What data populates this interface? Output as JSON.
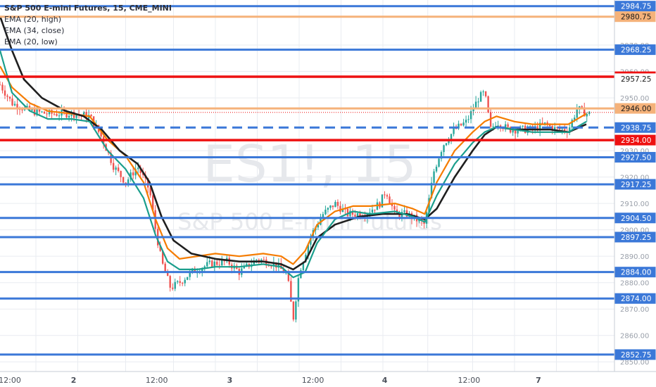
{
  "header": {
    "symbol_title": "S&P 500 E-mini Futures, 15, CME_MINI",
    "indicators": [
      "EMA (20, high)",
      "EMA (34, close)",
      "EMA (20, low)"
    ]
  },
  "watermark": {
    "big": "ES1!, 15",
    "small": "S&P 500 E-mini Futures"
  },
  "colors": {
    "background": "#ffffff",
    "grid": "#e9ecf1",
    "level_blue": "#3b78d8",
    "level_red": "#ee1111",
    "level_orange": "#f5b27a",
    "ema_high": "#f57c00",
    "ema_close": "#1f1f1f",
    "ema_low": "#1a9e8c",
    "candle_up": "#26a69a",
    "candle_down": "#ef5350"
  },
  "chart_data": {
    "type": "line",
    "ylim": [
      2849,
      2986
    ],
    "y_ticks": [
      2850,
      2860,
      2870,
      2880,
      2890,
      2900,
      2910,
      2920,
      2930,
      2950,
      2960,
      2970
    ],
    "x_labels": [
      "12:00",
      "2",
      "12:00",
      "3",
      "12:00",
      "4",
      "12:00",
      "7"
    ],
    "x_label_positions": [
      0.0,
      0.13,
      0.29,
      0.43,
      0.57,
      0.715,
      0.86,
      1.0
    ],
    "x_range": [
      0,
      1
    ],
    "levels": [
      {
        "value": 2984.75,
        "label": "2984.75",
        "style": "blue"
      },
      {
        "value": 2980.75,
        "label": "2980.75",
        "style": "orange"
      },
      {
        "value": 2968.25,
        "label": "2968.25",
        "style": "blue"
      },
      {
        "value": 2958.0,
        "label": "2958.00",
        "style": "red"
      },
      {
        "value": 2957.25,
        "label": "2957.25",
        "style": "plain"
      },
      {
        "value": 2946.0,
        "label": "2946.00",
        "style": "orange"
      },
      {
        "value": 2938.75,
        "label": "2938.75",
        "style": "blue-dashed"
      },
      {
        "value": 2934.0,
        "label": "2934.00",
        "style": "red"
      },
      {
        "value": 2927.5,
        "label": "2927.50",
        "style": "blue"
      },
      {
        "value": 2917.25,
        "label": "2917.25",
        "style": "blue"
      },
      {
        "value": 2904.5,
        "label": "2904.50",
        "style": "blue"
      },
      {
        "value": 2897.25,
        "label": "2897.25",
        "style": "blue"
      },
      {
        "value": 2884.0,
        "label": "2884.00",
        "style": "blue"
      },
      {
        "value": 2874.0,
        "label": "2874.00",
        "style": "blue"
      },
      {
        "value": 2852.75,
        "label": "2852.75",
        "style": "blue"
      }
    ],
    "last_price": 2944.5,
    "price_path": [
      [
        0.0,
        2955
      ],
      [
        0.02,
        2948
      ],
      [
        0.05,
        2945
      ],
      [
        0.08,
        2944
      ],
      [
        0.12,
        2944
      ],
      [
        0.15,
        2943
      ],
      [
        0.17,
        2935
      ],
      [
        0.19,
        2924
      ],
      [
        0.21,
        2918
      ],
      [
        0.23,
        2924
      ],
      [
        0.25,
        2915
      ],
      [
        0.26,
        2900
      ],
      [
        0.27,
        2888
      ],
      [
        0.285,
        2878
      ],
      [
        0.3,
        2880
      ],
      [
        0.32,
        2884
      ],
      [
        0.35,
        2887
      ],
      [
        0.38,
        2888
      ],
      [
        0.4,
        2884
      ],
      [
        0.43,
        2889
      ],
      [
        0.46,
        2887
      ],
      [
        0.48,
        2883
      ],
      [
        0.49,
        2866
      ],
      [
        0.5,
        2884
      ],
      [
        0.52,
        2898
      ],
      [
        0.54,
        2906
      ],
      [
        0.56,
        2910
      ],
      [
        0.58,
        2906
      ],
      [
        0.61,
        2906
      ],
      [
        0.635,
        2910
      ],
      [
        0.645,
        2915
      ],
      [
        0.66,
        2906
      ],
      [
        0.68,
        2906
      ],
      [
        0.71,
        2902
      ],
      [
        0.725,
        2922
      ],
      [
        0.74,
        2932
      ],
      [
        0.76,
        2938
      ],
      [
        0.78,
        2941
      ],
      [
        0.8,
        2950
      ],
      [
        0.81,
        2952
      ],
      [
        0.82,
        2938
      ],
      [
        0.83,
        2941
      ],
      [
        0.85,
        2938
      ],
      [
        0.87,
        2938
      ],
      [
        0.89,
        2938
      ],
      [
        0.91,
        2940
      ],
      [
        0.93,
        2938
      ],
      [
        0.95,
        2938
      ],
      [
        0.965,
        2946
      ],
      [
        0.98,
        2944
      ]
    ],
    "series": [
      {
        "name": "EMA (20, high)",
        "color_key": "ema_high",
        "points": [
          [
            0.0,
            2962
          ],
          [
            0.02,
            2954
          ],
          [
            0.05,
            2948
          ],
          [
            0.08,
            2945
          ],
          [
            0.12,
            2944
          ],
          [
            0.15,
            2943
          ],
          [
            0.18,
            2934
          ],
          [
            0.21,
            2928
          ],
          [
            0.24,
            2918
          ],
          [
            0.26,
            2904
          ],
          [
            0.28,
            2893
          ],
          [
            0.3,
            2889
          ],
          [
            0.33,
            2890
          ],
          [
            0.36,
            2891
          ],
          [
            0.4,
            2890
          ],
          [
            0.44,
            2891
          ],
          [
            0.47,
            2890
          ],
          [
            0.49,
            2887
          ],
          [
            0.51,
            2892
          ],
          [
            0.53,
            2902
          ],
          [
            0.56,
            2907
          ],
          [
            0.59,
            2909
          ],
          [
            0.62,
            2909
          ],
          [
            0.66,
            2910
          ],
          [
            0.69,
            2908
          ],
          [
            0.71,
            2906
          ],
          [
            0.73,
            2918
          ],
          [
            0.76,
            2930
          ],
          [
            0.79,
            2937
          ],
          [
            0.81,
            2941
          ],
          [
            0.83,
            2943
          ],
          [
            0.86,
            2941
          ],
          [
            0.89,
            2940
          ],
          [
            0.92,
            2940
          ],
          [
            0.95,
            2940
          ],
          [
            0.98,
            2944
          ]
        ]
      },
      {
        "name": "EMA (34, close)",
        "color_key": "ema_close",
        "points": [
          [
            0.0,
            2981
          ],
          [
            0.02,
            2968
          ],
          [
            0.04,
            2957
          ],
          [
            0.07,
            2950
          ],
          [
            0.11,
            2945
          ],
          [
            0.14,
            2943
          ],
          [
            0.17,
            2938
          ],
          [
            0.2,
            2930
          ],
          [
            0.23,
            2925
          ],
          [
            0.25,
            2918
          ],
          [
            0.27,
            2905
          ],
          [
            0.29,
            2896
          ],
          [
            0.32,
            2891
          ],
          [
            0.36,
            2889
          ],
          [
            0.4,
            2888
          ],
          [
            0.44,
            2888
          ],
          [
            0.47,
            2887
          ],
          [
            0.49,
            2885
          ],
          [
            0.51,
            2888
          ],
          [
            0.53,
            2897
          ],
          [
            0.56,
            2902
          ],
          [
            0.6,
            2905
          ],
          [
            0.64,
            2906
          ],
          [
            0.68,
            2906
          ],
          [
            0.71,
            2904
          ],
          [
            0.73,
            2908
          ],
          [
            0.76,
            2920
          ],
          [
            0.79,
            2930
          ],
          [
            0.81,
            2936
          ],
          [
            0.83,
            2939
          ],
          [
            0.86,
            2938
          ],
          [
            0.89,
            2938
          ],
          [
            0.92,
            2938
          ],
          [
            0.95,
            2937
          ],
          [
            0.98,
            2940
          ]
        ]
      },
      {
        "name": "EMA (20, low)",
        "color_key": "ema_low",
        "points": [
          [
            0.0,
            2968
          ],
          [
            0.02,
            2952
          ],
          [
            0.05,
            2945
          ],
          [
            0.08,
            2942
          ],
          [
            0.12,
            2942
          ],
          [
            0.15,
            2941
          ],
          [
            0.18,
            2930
          ],
          [
            0.21,
            2923
          ],
          [
            0.24,
            2912
          ],
          [
            0.26,
            2898
          ],
          [
            0.28,
            2888
          ],
          [
            0.3,
            2885
          ],
          [
            0.33,
            2885
          ],
          [
            0.36,
            2886
          ],
          [
            0.4,
            2886
          ],
          [
            0.44,
            2887
          ],
          [
            0.47,
            2886
          ],
          [
            0.49,
            2882
          ],
          [
            0.51,
            2884
          ],
          [
            0.53,
            2895
          ],
          [
            0.56,
            2904
          ],
          [
            0.59,
            2907
          ],
          [
            0.62,
            2906
          ],
          [
            0.66,
            2907
          ],
          [
            0.69,
            2905
          ],
          [
            0.71,
            2903
          ],
          [
            0.73,
            2913
          ],
          [
            0.76,
            2925
          ],
          [
            0.79,
            2933
          ],
          [
            0.81,
            2937
          ],
          [
            0.83,
            2939
          ],
          [
            0.86,
            2938
          ],
          [
            0.89,
            2937
          ],
          [
            0.92,
            2937
          ],
          [
            0.95,
            2937
          ],
          [
            0.98,
            2941
          ]
        ]
      }
    ]
  }
}
